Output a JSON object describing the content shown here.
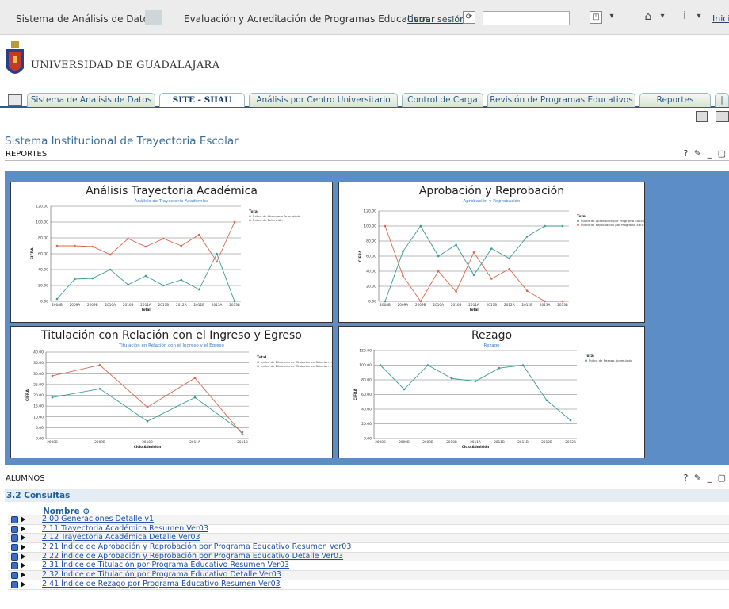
{
  "topbar": {
    "app_title": "Sistema de Análisis de Datos",
    "context_title": "Evaluación y Acreditación de Programas Educativos",
    "logout_label": "Cerrar sesión",
    "search_value": "",
    "home_label": "Inicio"
  },
  "header": {
    "university_name": "UNIVERSIDAD DE GUADALAJARA"
  },
  "tabs": [
    {
      "label": "Sistema de Analisis de Datos",
      "active": false
    },
    {
      "label": "SITE - SIIAU",
      "active": true
    },
    {
      "label": "Análisis por Centro Universitario",
      "active": false
    },
    {
      "label": "Control de Carga",
      "active": false
    },
    {
      "label": "Revisión de Programas Educativos",
      "active": false
    },
    {
      "label": "Reportes",
      "active": false
    }
  ],
  "page_title": "Sistema Institucional de Trayectoria Escolar",
  "reportes_section": {
    "label": "REPORTES",
    "controls": "? ✎ _ ▢"
  },
  "alumnos_section": {
    "label": "ALUMNOS",
    "controls": "? ✎ _ ▢"
  },
  "chart_data": [
    {
      "type": "line",
      "title": "Análisis Trayectoria Académica",
      "subtitle": "Análisis de Trayectoria Académica",
      "ylabel": "CIFRA",
      "xlabel": "Total",
      "ylim": [
        0,
        120
      ],
      "yticks": [
        "0.00",
        "20.00",
        "40.00",
        "60.00",
        "80.00",
        "100.00",
        "120.00"
      ],
      "legend_title": "Total",
      "legend_position": "right",
      "categories": [
        "2008B",
        "2009A",
        "2009B",
        "2010A",
        "2010B",
        "2011A",
        "2011B",
        "2012A",
        "2012B",
        "2013A",
        "2013B"
      ],
      "series": [
        {
          "name": "Índice de Abandono Acumulado",
          "color": "#3a9a94",
          "values": [
            3,
            28,
            29,
            40,
            21,
            32,
            20,
            27,
            15,
            60,
            0
          ]
        },
        {
          "name": "Índice de Retención",
          "color": "#d9674a",
          "values": [
            70,
            70,
            69,
            59,
            79,
            69,
            79,
            70,
            84,
            50,
            100
          ]
        }
      ]
    },
    {
      "type": "line",
      "title": "Aprobación y Reprobación",
      "subtitle": "Aprobación y Reprobación",
      "ylabel": "CIFRA",
      "xlabel": "Total",
      "ylim": [
        0,
        120
      ],
      "yticks": [
        "0.00",
        "20.00",
        "40.00",
        "60.00",
        "80.00",
        "100.00",
        "120.00"
      ],
      "legend_title": "Total",
      "legend_position": "right",
      "categories": [
        "2008B",
        "2009A",
        "2009B",
        "2010A",
        "2010B",
        "2011A",
        "2011B",
        "2012A",
        "2012B",
        "2013A",
        "2013B"
      ],
      "series": [
        {
          "name": "Índice de Aprobación por Programa Educativo",
          "color": "#3a9a94",
          "values": [
            0,
            66,
            100,
            60,
            75,
            35,
            70,
            57,
            86,
            100,
            100
          ]
        },
        {
          "name": "Índice de Reprobación por Programa Educativo",
          "color": "#d9674a",
          "values": [
            100,
            34,
            0,
            40,
            13,
            65,
            30,
            43,
            14,
            0,
            0
          ]
        }
      ]
    },
    {
      "type": "line",
      "title": "Titulación con Relación con el Ingreso y Egreso",
      "subtitle": "Titulación en Relación con el Ingreso y el Egreso",
      "ylabel": "CIFRA",
      "xlabel": "Ciclo Admisión",
      "ylim": [
        0,
        40
      ],
      "yticks": [
        "0.00",
        "5.00",
        "10.00",
        "15.00",
        "20.00",
        "25.00",
        "30.00",
        "35.00",
        "40.00"
      ],
      "legend_title": "Total",
      "legend_position": "right",
      "categories": [
        "2008B",
        "2009B",
        "2010B",
        "2011A",
        "2011B"
      ],
      "series": [
        {
          "name": "Índice de Eficiencia de Titulación en Relación c...",
          "color": "#3a9a94",
          "values": [
            19,
            23,
            8,
            19,
            3
          ]
        },
        {
          "name": "Índice de Eficiencia de Titulación en Relación c...",
          "color": "#d9674a",
          "values": [
            29,
            34,
            14.5,
            28,
            2
          ]
        }
      ]
    },
    {
      "type": "line",
      "title": "Rezago",
      "subtitle": "Rezago",
      "ylabel": "CIFRA",
      "xlabel": "Ciclo Admisión",
      "ylim": [
        0,
        120
      ],
      "yticks": [
        "0.00",
        "20.00",
        "40.00",
        "60.00",
        "80.00",
        "100.00",
        "120.00"
      ],
      "legend_title": "Total",
      "legend_position": "right",
      "categories": [
        "2008B",
        "2009B",
        "2009B",
        "2010B",
        "2011A",
        "2011B",
        "2011B",
        "2012B",
        "2012B"
      ],
      "series": [
        {
          "name": "Índice de Rezago Acumulado",
          "color": "#3a9a94",
          "values": [
            100,
            67,
            100,
            82,
            78,
            96,
            100,
            52,
            25
          ]
        }
      ]
    }
  ],
  "consultas": {
    "title": "3.2 Consultas",
    "column_header": "Nombre ⊕",
    "items": [
      "2.00 Generaciones Detalle v1",
      "2.11 Trayectoria Académica Resumen Ver03",
      "2.12 Trayectoria Académica Detalle Ver03",
      "2.21 Índice de Aprobación y Reprobación por Programa Educativo Resumen Ver03",
      "2.22 Índice de Aprobación y Reprobación por Programa Educativo Detalle Ver03",
      "2.31 Índice de Titulación por Programa Educativo Resumen Ver03",
      "2.32 Índice de Titulación por Programa Educativo Detalle Ver03",
      "2.41 Índice de Rezago por Programa Educativo Resumen Ver03"
    ]
  }
}
